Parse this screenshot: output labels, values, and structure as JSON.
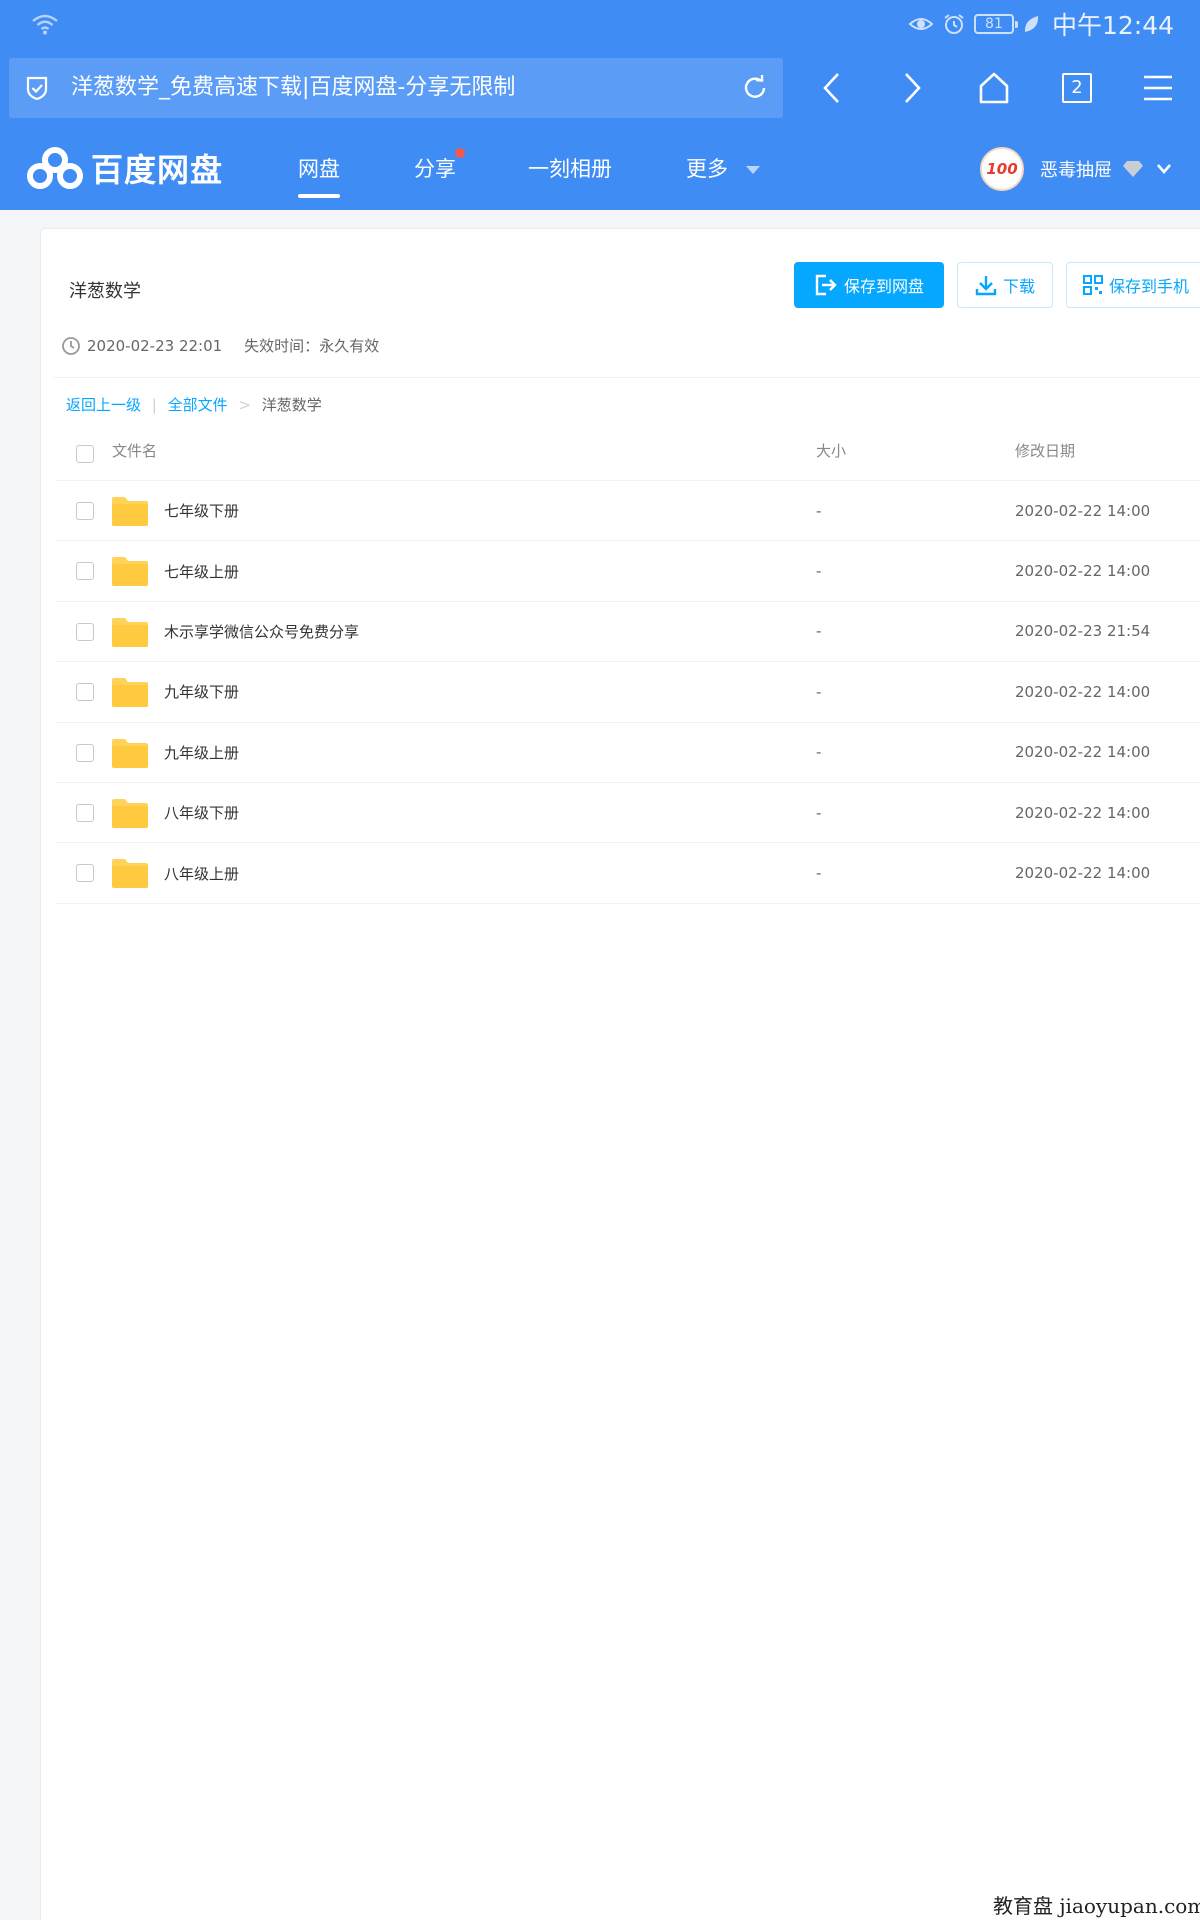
{
  "status_bar": {
    "battery": "81",
    "time": "中午12:44"
  },
  "browser": {
    "url_title": "洋葱数学_免费高速下载|百度网盘-分享无限制",
    "tab_count": "2"
  },
  "site": {
    "logo_text": "百度网盘",
    "nav": [
      "网盘",
      "分享",
      "一刻相册",
      "更多"
    ],
    "avatar_badge": "100",
    "username": "恶毒抽屉"
  },
  "share": {
    "title": "洋葱数学",
    "buttons": {
      "save": "保存到网盘",
      "download": "下载",
      "save_mobile": "保存到手机"
    },
    "created": "2020-02-23 22:01",
    "expire_label": "失效时间：",
    "expire_value": "永久有效"
  },
  "breadcrumb": {
    "back": "返回上一级",
    "all": "全部文件",
    "sep": ">",
    "current": "洋葱数学"
  },
  "table": {
    "headers": {
      "name": "文件名",
      "size": "大小",
      "date": "修改日期"
    },
    "rows": [
      {
        "name": "七年级下册",
        "size": "-",
        "date": "2020-02-22 14:00"
      },
      {
        "name": "七年级上册",
        "size": "-",
        "date": "2020-02-22 14:00"
      },
      {
        "name": "木示享学微信公众号免费分享",
        "size": "-",
        "date": "2020-02-23 21:54"
      },
      {
        "name": "九年级下册",
        "size": "-",
        "date": "2020-02-22 14:00"
      },
      {
        "name": "九年级上册",
        "size": "-",
        "date": "2020-02-22 14:00"
      },
      {
        "name": "八年级下册",
        "size": "-",
        "date": "2020-02-22 14:00"
      },
      {
        "name": "八年级上册",
        "size": "-",
        "date": "2020-02-22 14:00"
      }
    ]
  },
  "watermark": "教育盘 jiaoyupan.com",
  "colors": {
    "brand_blue": "#3f8cf5",
    "button_blue": "#06a7ff",
    "folder_yellow": "#ffd35a"
  },
  "icons": {
    "status": [
      "wifi-icon",
      "eye-icon",
      "alarm-icon",
      "battery-icon",
      "leaf-icon"
    ],
    "browser": [
      "shield-icon",
      "reload-icon",
      "back-icon",
      "forward-icon",
      "home-icon",
      "tabs-icon",
      "menu-icon"
    ],
    "share": [
      "save-to-cloud-icon",
      "download-icon",
      "qrcode-icon",
      "clock-icon",
      "folder-icon"
    ]
  }
}
